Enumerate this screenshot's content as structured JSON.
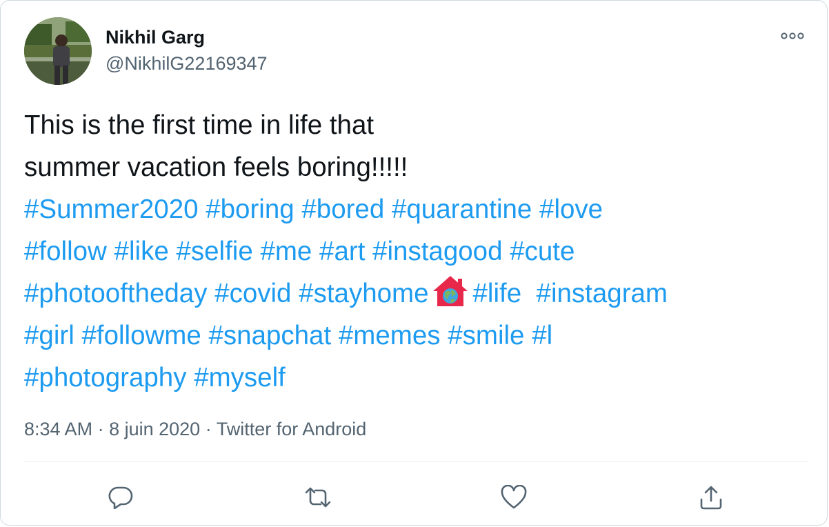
{
  "author": {
    "name": "Nikhil Garg",
    "handle": "@NikhilG22169347"
  },
  "tweet": {
    "line1": "This is the first time in life that",
    "line2": "summer vacation feels boring!!!!!",
    "hashtags_row1": [
      "#Summer2020",
      "#boring",
      "#bored",
      "#quarantine",
      "#love"
    ],
    "hashtags_row2": [
      "#follow",
      "#like",
      "#selfie",
      "#me",
      "#art",
      "#instagood",
      "#cute"
    ],
    "hashtags_row3_a": [
      "#photooftheday",
      "#covid",
      "#stayhome"
    ],
    "hashtags_row3_b": [
      "#life",
      "#instagram"
    ],
    "hashtags_row4": [
      "#girl",
      "#followme",
      "#snapchat",
      "#memes",
      "#smile",
      "#l"
    ],
    "hashtags_row5": [
      "#photography",
      "#myself"
    ],
    "emoji": "house-with-earth-emoji"
  },
  "meta": {
    "time": "8:34 AM",
    "sep1": " · ",
    "date": "8 juin 2020",
    "sep2": " · ",
    "source": "Twitter for Android"
  },
  "icons": {
    "more": "more-dots-icon",
    "reply": "reply-icon",
    "retweet": "retweet-icon",
    "like": "heart-icon",
    "share": "share-icon"
  },
  "colors": {
    "hashtag": "#1d9bf0",
    "text": "#0f1419",
    "secondary": "#536471",
    "emoji_house": "#e8284a",
    "emoji_earth_land": "#7bb661",
    "emoji_earth_sea": "#3fa7e0"
  }
}
